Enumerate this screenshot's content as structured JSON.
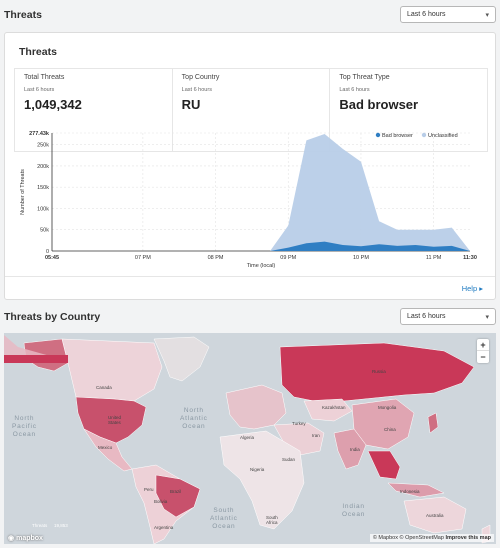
{
  "threats_section": {
    "title": "Threats",
    "range_select": "Last 6 hours"
  },
  "threats_card": {
    "title": "Threats",
    "stats": [
      {
        "label": "Total Threats",
        "sub": "Last 6 hours",
        "value": "1,049,342"
      },
      {
        "label": "Top Country",
        "sub": "Last 6 hours",
        "value": "RU"
      },
      {
        "label": "Top Threat Type",
        "sub": "Last 6 hours",
        "value": "Bad browser"
      }
    ],
    "help_label": "Help"
  },
  "chart_data": {
    "type": "area",
    "xlabel": "Time (local)",
    "ylabel": "Number of Threats",
    "x_ticks": [
      "05:45",
      "07 PM",
      "08 PM",
      "09 PM",
      "10 PM",
      "11 PM",
      "11:30"
    ],
    "y_ticks": [
      "0",
      "50k",
      "100k",
      "150k",
      "200k",
      "250k",
      "277.43k"
    ],
    "ylim": [
      0,
      277430
    ],
    "x": [
      0,
      0.5,
      1.0,
      1.5,
      2.0,
      2.5,
      3.0,
      3.25,
      3.5,
      3.75,
      4.0,
      4.25,
      4.5,
      4.75,
      5.0,
      5.25,
      5.5,
      5.75
    ],
    "series": [
      {
        "name": "Bad browser",
        "color": "#2f7ec3",
        "values": [
          0,
          0,
          0,
          0,
          0,
          0,
          0,
          8000,
          18000,
          22000,
          14000,
          11000,
          16000,
          12000,
          14000,
          10000,
          12000,
          0
        ]
      },
      {
        "name": "Unclassified",
        "color": "#b8cde8",
        "values": [
          0,
          0,
          0,
          0,
          0,
          0,
          0,
          60000,
          260000,
          275000,
          240000,
          210000,
          70000,
          50000,
          50000,
          50000,
          55000,
          0
        ]
      }
    ],
    "legend_position": "top-right",
    "grid": true
  },
  "country_section": {
    "title": "Threats by Country",
    "range_select": "Last 6 hours"
  },
  "map": {
    "zoom_in": "+",
    "zoom_out": "−",
    "attribution": "© Mapbox © OpenStreetMap",
    "improve": "Improve this map",
    "logo": "mapbox",
    "legend_left": "Threats",
    "legend_right": "19,853",
    "oceans": {
      "north_atlantic": "North\nAtlantic\nOcean",
      "north_pacific": "North\nPacific\nOcean",
      "south_atlantic": "South\nAtlantic\nOcean",
      "indian": "Indian\nOcean"
    },
    "places": {
      "canada": "Canada",
      "united_states": "United\nStates",
      "mexico": "Mexico",
      "russia": "Russia",
      "kazakhstan": "Kazakhstan",
      "mongolia": "Mongolia",
      "china": "China",
      "india": "India",
      "brazil": "Brazil",
      "australia": "Australia",
      "algeria": "Algeria",
      "sudan": "Sudan",
      "iran": "Iran",
      "turkey": "Turkey",
      "peru": "Peru",
      "bolivia": "Bolivia",
      "nigeria": "Nigeria",
      "indonesia": "Indonesia",
      "argentina": "Argentina",
      "south_africa": "South\nAfrica"
    }
  }
}
